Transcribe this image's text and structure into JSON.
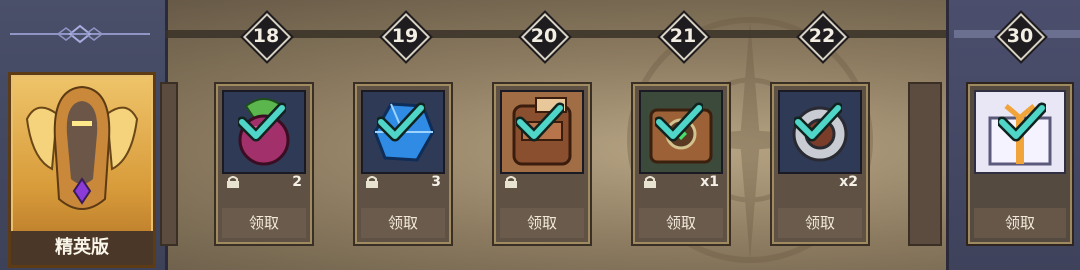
{
  "elite": {
    "label": "精英版"
  },
  "milestones": [
    {
      "level": "18",
      "count": "2",
      "claim_label": "领取",
      "locked": true,
      "claimed": true,
      "item_icon": "berry-icon"
    },
    {
      "level": "19",
      "count": "3",
      "claim_label": "领取",
      "locked": true,
      "claimed": true,
      "item_icon": "crystal-gem-icon"
    },
    {
      "level": "20",
      "count": "",
      "claim_label": "领取",
      "locked": true,
      "claimed": true,
      "item_icon": "backpack-icon"
    },
    {
      "level": "21",
      "count": "x1",
      "claim_label": "领取",
      "locked": true,
      "claimed": true,
      "item_icon": "treasure-chest-icon"
    },
    {
      "level": "22",
      "count": "x2",
      "claim_label": "领取",
      "locked": false,
      "claimed": true,
      "item_icon": "ring-icon"
    }
  ],
  "final_milestone": {
    "level": "30",
    "claim_label": "领取",
    "claimed": true,
    "item_icon": "gift-box-icon"
  },
  "colors": {
    "check": "#4fd6c8",
    "track": "#3a3128",
    "side_panel": "#474b66"
  }
}
